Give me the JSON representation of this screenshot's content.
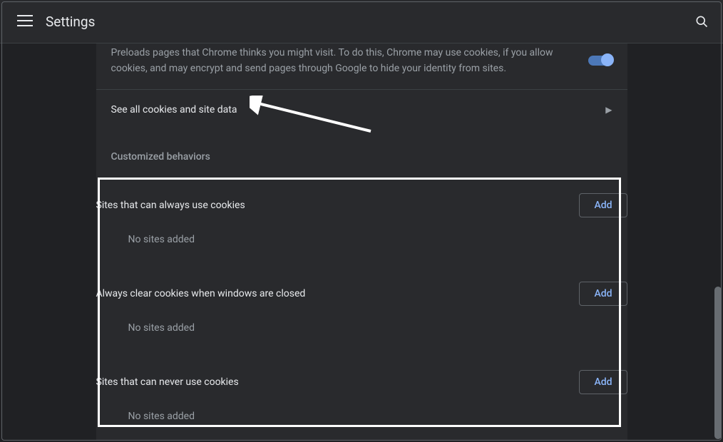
{
  "toolbar": {
    "title": "Settings"
  },
  "preload": {
    "description": "Preloads pages that Chrome thinks you might visit. To do this, Chrome may use cookies, if you allow cookies, and may encrypt and send pages through Google to hide your identity from sites.",
    "toggled_on": true
  },
  "see_all_cookies_label": "See all cookies and site data",
  "custom_section_header": "Customized behaviors",
  "add_button_label": "Add",
  "blocks": [
    {
      "title": "Sites that can always use cookies",
      "empty_text": "No sites added"
    },
    {
      "title": "Always clear cookies when windows are closed",
      "empty_text": "No sites added"
    },
    {
      "title": "Sites that can never use cookies",
      "empty_text": "No sites added"
    }
  ]
}
